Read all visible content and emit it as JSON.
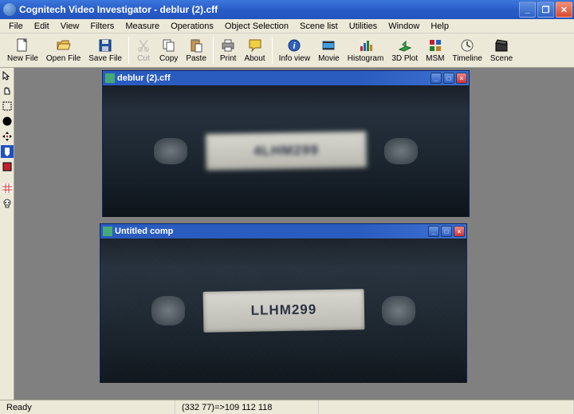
{
  "app": {
    "title": "Cognitech Video Investigator - deblur (2).cff"
  },
  "menu": {
    "items": [
      "File",
      "Edit",
      "View",
      "Filters",
      "Measure",
      "Operations",
      "Object Selection",
      "Scene list",
      "Utilities",
      "Window",
      "Help"
    ]
  },
  "toolbar": {
    "newfile": "New File",
    "openfile": "Open File",
    "savefile": "Save File",
    "cut": "Cut",
    "copy": "Copy",
    "paste": "Paste",
    "print": "Print",
    "about": "About",
    "infoview": "Info view",
    "movie": "Movie",
    "histogram": "Histogram",
    "plot3d": "3D Plot",
    "msm": "MSM",
    "timeline": "Timeline",
    "scene": "Scene"
  },
  "windows": {
    "top": {
      "title": "deblur (2).cff",
      "plate": "4LHM299"
    },
    "bottom": {
      "title": "Untitled comp",
      "plate": "LLHM299"
    }
  },
  "status": {
    "ready": "Ready",
    "coord": "(332 77)=>109 112 118"
  }
}
